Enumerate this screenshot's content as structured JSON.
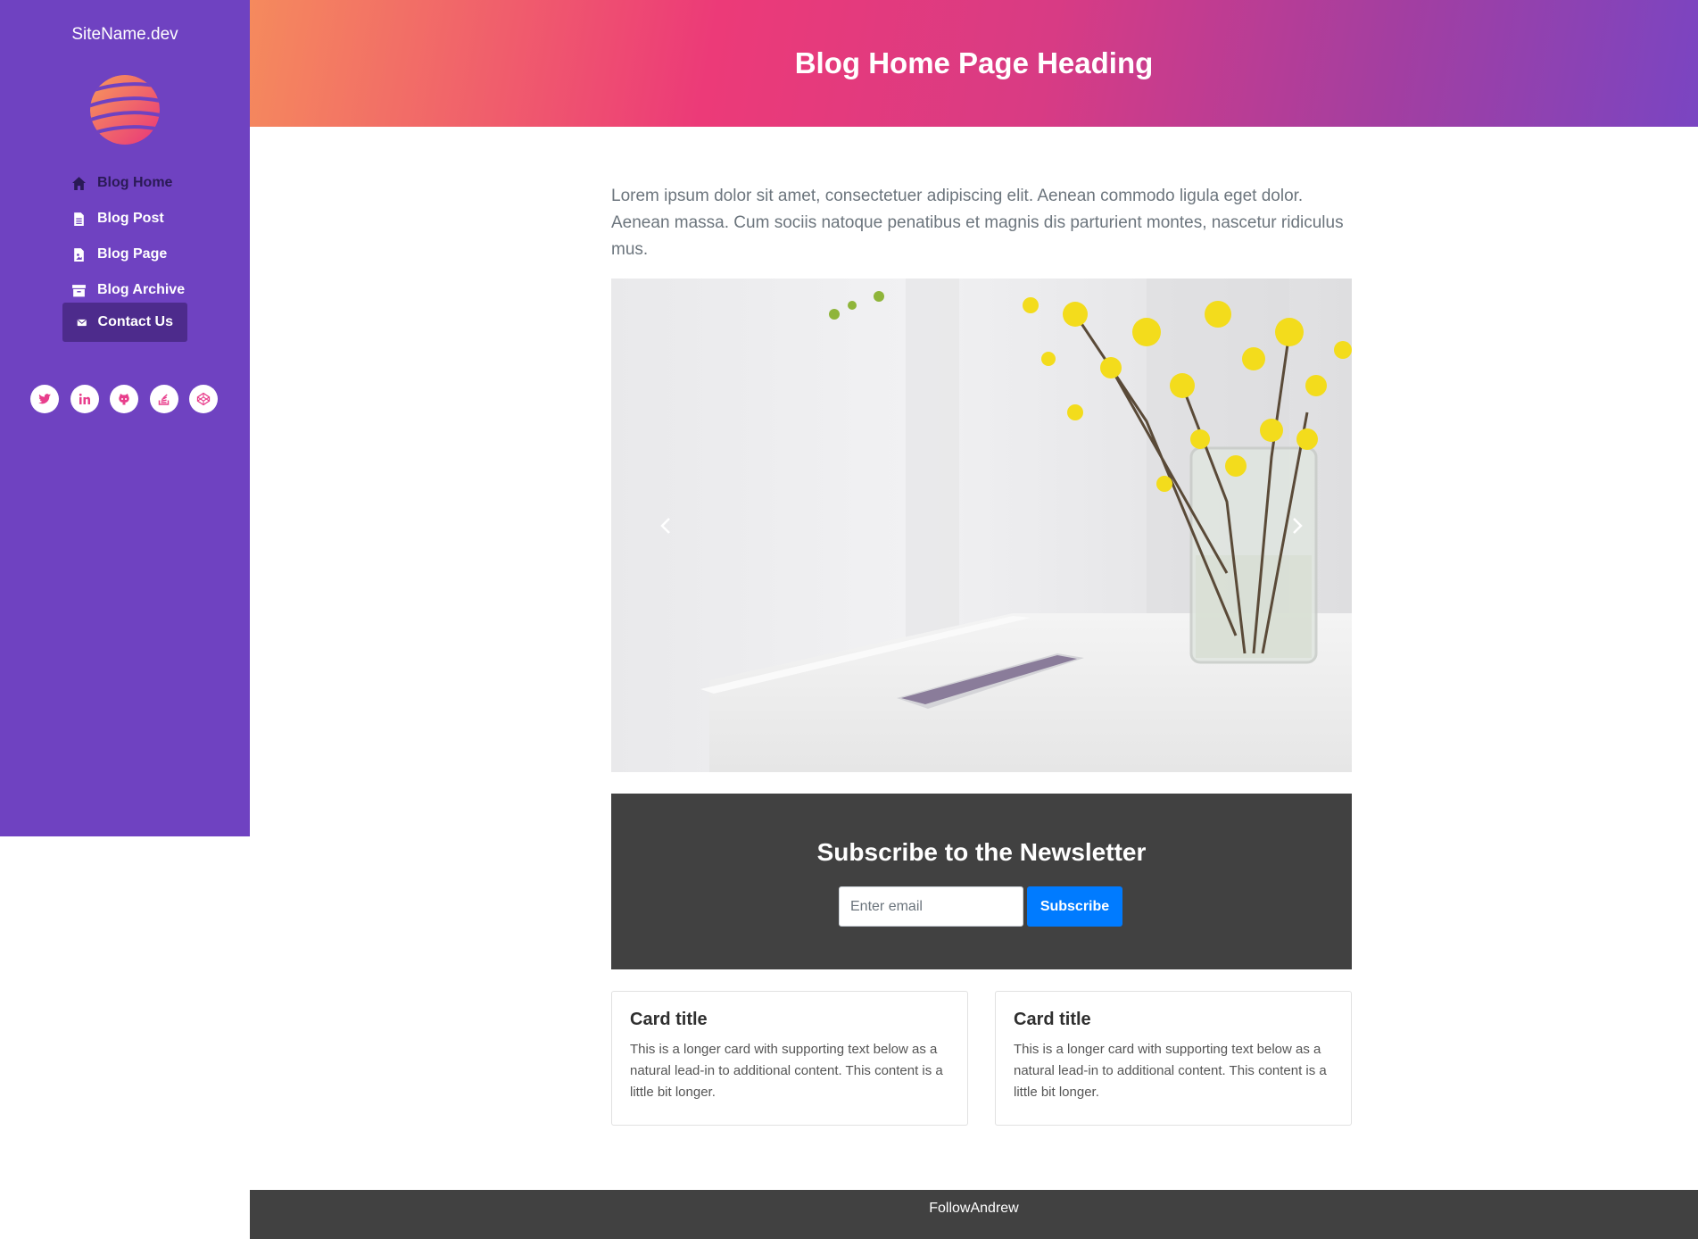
{
  "sidebar": {
    "site_name": "SiteName.dev",
    "nav": [
      {
        "label": "Blog Home",
        "icon": "home-icon"
      },
      {
        "label": "Blog Post",
        "icon": "file-icon"
      },
      {
        "label": "Blog Page",
        "icon": "file-image-icon"
      },
      {
        "label": "Blog Archive",
        "icon": "archive-icon"
      },
      {
        "label": "Contact Us",
        "icon": "envelope-icon"
      }
    ],
    "socials": [
      "twitter-icon",
      "linkedin-icon",
      "github-icon",
      "stackoverflow-icon",
      "codepen-icon"
    ],
    "colors": {
      "background": "#6f42c1",
      "active": "#4d2b8c",
      "social_icon": "#e83e8c"
    }
  },
  "header": {
    "title": "Blog Home Page Heading"
  },
  "main": {
    "intro": "Lorem ipsum dolor sit amet, consectetuer adipiscing elit. Aenean commodo ligula eget dolor. Aenean massa. Cum sociis natoque penatibus et magnis dis parturient montes, nascetur ridiculus mus.",
    "newsletter": {
      "title": "Subscribe to the Newsletter",
      "email_placeholder": "Enter email",
      "button_label": "Subscribe"
    },
    "cards": [
      {
        "title": "Card title",
        "text": "This is a longer card with supporting text below as a natural lead-in to additional content. This content is a little bit longer."
      },
      {
        "title": "Card title",
        "text": "This is a longer card with supporting text below as a natural lead-in to additional content. This content is a little bit longer."
      }
    ]
  },
  "footer": {
    "text": "FollowAndrew"
  }
}
